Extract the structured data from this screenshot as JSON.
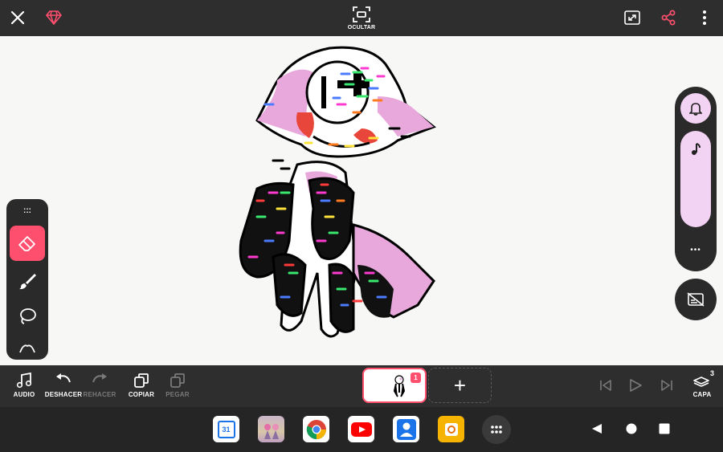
{
  "topbar": {
    "hide_label": "OCULTAR"
  },
  "side_panel": {
    "more": "•••"
  },
  "left_tools": {
    "handle": ":::"
  },
  "bottom": {
    "audio": "AUDIO",
    "undo": "DESHACER",
    "redo": "REHACER",
    "copy": "COPIAR",
    "paste": "PEGAR",
    "layer": "CAPA",
    "layer_count": "3",
    "frame_badge": "1",
    "add": "+"
  },
  "dock": {
    "calendar_day": "31"
  },
  "colors": {
    "accent": "#ff4f6e",
    "bar": "#2e2e2e",
    "panel_pink": "#f3d3f3"
  },
  "icons": [
    "close-icon",
    "diamond-icon",
    "hide-frame-icon",
    "fullscreen-icon",
    "share-icon",
    "more-vert-icon",
    "bell-icon",
    "music-note-icon",
    "ellipsis-icon",
    "subtitles-off-icon",
    "eraser-icon",
    "brush-icon",
    "lasso-icon",
    "smudge-icon",
    "audio-icon",
    "undo-icon",
    "redo-icon",
    "copy-icon",
    "paste-icon",
    "layers-icon",
    "first-frame-icon",
    "play-icon",
    "last-frame-icon",
    "calendar-icon",
    "photos-icon",
    "chrome-icon",
    "youtube-icon",
    "contacts-icon",
    "notes-icon",
    "app-drawer-icon",
    "back-icon",
    "home-icon",
    "recents-icon"
  ]
}
